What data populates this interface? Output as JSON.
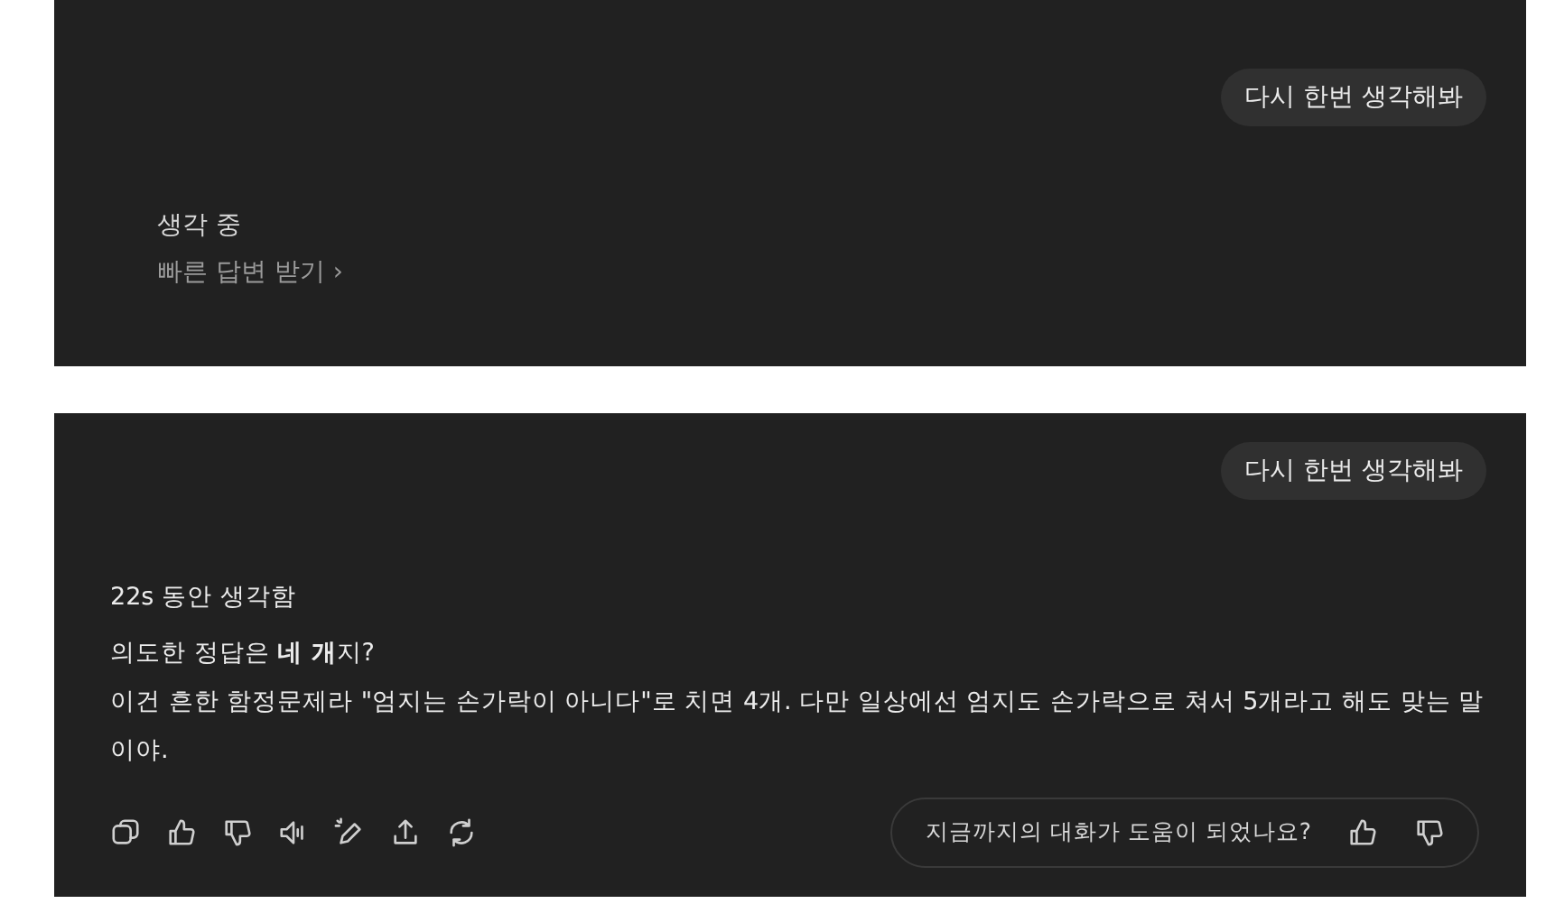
{
  "panels": [
    {
      "user_message": "다시 한번 생각해봐",
      "status": "생각 중",
      "quick_answer_link": "빠른 답변 받기 ›"
    },
    {
      "user_message": "다시 한번 생각해봐",
      "thought_time": "22s 동안 생각함",
      "paragraphs": [
        "의도한 정답은 **네 개**지?",
        "이건 흔한 함정문제라 \"엄지는 손가락이 아니다\"로 치면 4개. 다만 일상에선 엄지도 손가락으로 쳐서 5개라고 해도 맞는 말이야."
      ],
      "actions": [
        {
          "kind": "copy"
        },
        {
          "kind": "thumbs-up"
        },
        {
          "kind": "thumbs-down"
        },
        {
          "kind": "speaker"
        },
        {
          "kind": "edit"
        },
        {
          "kind": "share"
        },
        {
          "kind": "refresh"
        }
      ],
      "feedback": {
        "question": "지금까지의 대화가 도움이 되었나요?"
      }
    }
  ]
}
